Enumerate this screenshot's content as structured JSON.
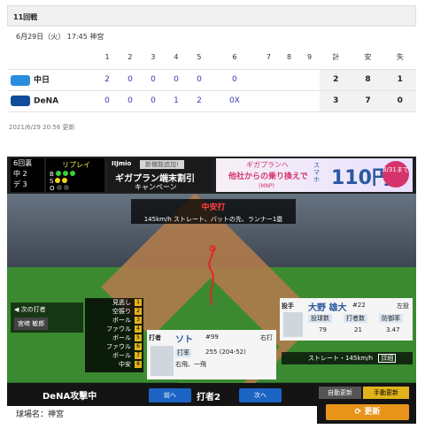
{
  "header": {
    "title": "11回戦"
  },
  "game_info": {
    "date": "6月29日（火） 17:45 神宮"
  },
  "scoreboard": {
    "innings": [
      "1",
      "2",
      "3",
      "4",
      "5",
      "6",
      "7",
      "8",
      "9"
    ],
    "totals_headers": [
      "計",
      "安",
      "失"
    ],
    "teams": [
      {
        "name": "中日",
        "color": "#2a8de0",
        "innings": [
          "2",
          "0",
          "0",
          "0",
          "0",
          "0",
          "",
          "",
          ""
        ],
        "totals": [
          "2",
          "8",
          "1"
        ]
      },
      {
        "name": "DeNA",
        "color": "#0f4c9a",
        "innings": [
          "0",
          "0",
          "0",
          "1",
          "2",
          "0X",
          "",
          "",
          ""
        ],
        "totals": [
          "3",
          "7",
          "0"
        ]
      }
    ]
  },
  "updated": "2021/6/29 20:56 更新",
  "game_panel": {
    "inning": "6回裏",
    "inning_lines": [
      "中 2",
      "デ 3"
    ],
    "replay_label": "リプレイ",
    "bso_labels": [
      "B",
      "S",
      "O"
    ],
    "ad1": {
      "brand": "IIJmio",
      "badge": "新機能追加!",
      "line1": "ギガプラン端末割引",
      "line2": "キャンペーン"
    },
    "ad2": {
      "line1": "ギガプランへ",
      "line2": "他社からの乗り換えで",
      "line3": "(MNP)",
      "vertical": "スマホ",
      "price": "110円",
      "circle": "8/31まで"
    },
    "play": {
      "title": "中安打",
      "desc": "145km/h ストレート、バットの先、ランナー1塁"
    },
    "next_batter": {
      "label": "次の打者",
      "name": "宮﨑 敏郎"
    },
    "history": [
      {
        "text": "見逃し",
        "num": "1"
      },
      {
        "text": "空振り",
        "num": "2"
      },
      {
        "text": "ボール",
        "num": "3"
      },
      {
        "text": "ファウル",
        "num": "4"
      },
      {
        "text": "ボール",
        "num": "5"
      },
      {
        "text": "ファウル",
        "num": "6"
      },
      {
        "text": "ボール",
        "num": "7"
      },
      {
        "text": "中安",
        "num": "8"
      }
    ],
    "batter": {
      "label": "打者",
      "name": "ソト",
      "number": "#99",
      "hand": "右打",
      "stat_label": "打率",
      "stat_value": "255 (204-52)",
      "recent": "右飛、一飛"
    },
    "pitcher": {
      "label": "投手",
      "name": "大野 雄大",
      "number": "#22",
      "hand": "左投",
      "headers": [
        "投球数",
        "打者数",
        "防御率"
      ],
      "values": [
        "79",
        "21",
        "3.47"
      ]
    },
    "pitch_info": {
      "text": "ストレート・145km/h",
      "detail": "詳細"
    },
    "bottom": {
      "attack": "DeNA攻撃中",
      "prev": "前へ",
      "batter_index": "打者2",
      "next": "次へ",
      "auto": "自動更新",
      "manual": "手動更新",
      "refresh": "更新",
      "stadium": "球場名：神宮"
    }
  }
}
